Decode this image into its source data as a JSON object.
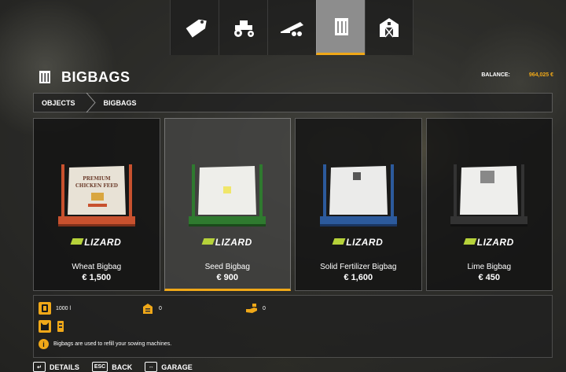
{
  "tabs": [
    {
      "icon": "price-tag-icon"
    },
    {
      "icon": "tractor-icon"
    },
    {
      "icon": "trailer-icon"
    },
    {
      "icon": "bigbag-category-icon",
      "active": true
    },
    {
      "icon": "barn-icon"
    }
  ],
  "header": {
    "title": "BIGBAGS",
    "balance_label": "BALANCE:",
    "balance_value": "964,025 €"
  },
  "breadcrumb": [
    "OBJECTS",
    "BIGBAGS"
  ],
  "products": [
    {
      "name": "Wheat Bigbag",
      "price": "€ 1,500",
      "brand": "LIZARD",
      "frame_color": "#c8512e",
      "bag_print": "PREMIUM CHICKEN FEED"
    },
    {
      "name": "Seed Bigbag",
      "price": "€ 900",
      "brand": "LIZARD",
      "frame_color": "#2f7a2f",
      "selected": true
    },
    {
      "name": "Solid Fertilizer Bigbag",
      "price": "€ 1,600",
      "brand": "LIZARD",
      "frame_color": "#2c5a9c"
    },
    {
      "name": "Lime Bigbag",
      "price": "€ 450",
      "brand": "LIZARD",
      "frame_color": "#333333"
    }
  ],
  "details": {
    "capacity": "1000 l",
    "storage_count": "0",
    "hand_count": "0",
    "info_text": "Bigbags are used to refill your sowing machines."
  },
  "footer": [
    {
      "key": "↵",
      "label": "DETAILS"
    },
    {
      "key": "ESC",
      "label": "BACK"
    },
    {
      "key": "↔",
      "label": "GARAGE"
    }
  ],
  "colors": {
    "accent": "#f0a818",
    "brand_green": "#b6d23a"
  }
}
